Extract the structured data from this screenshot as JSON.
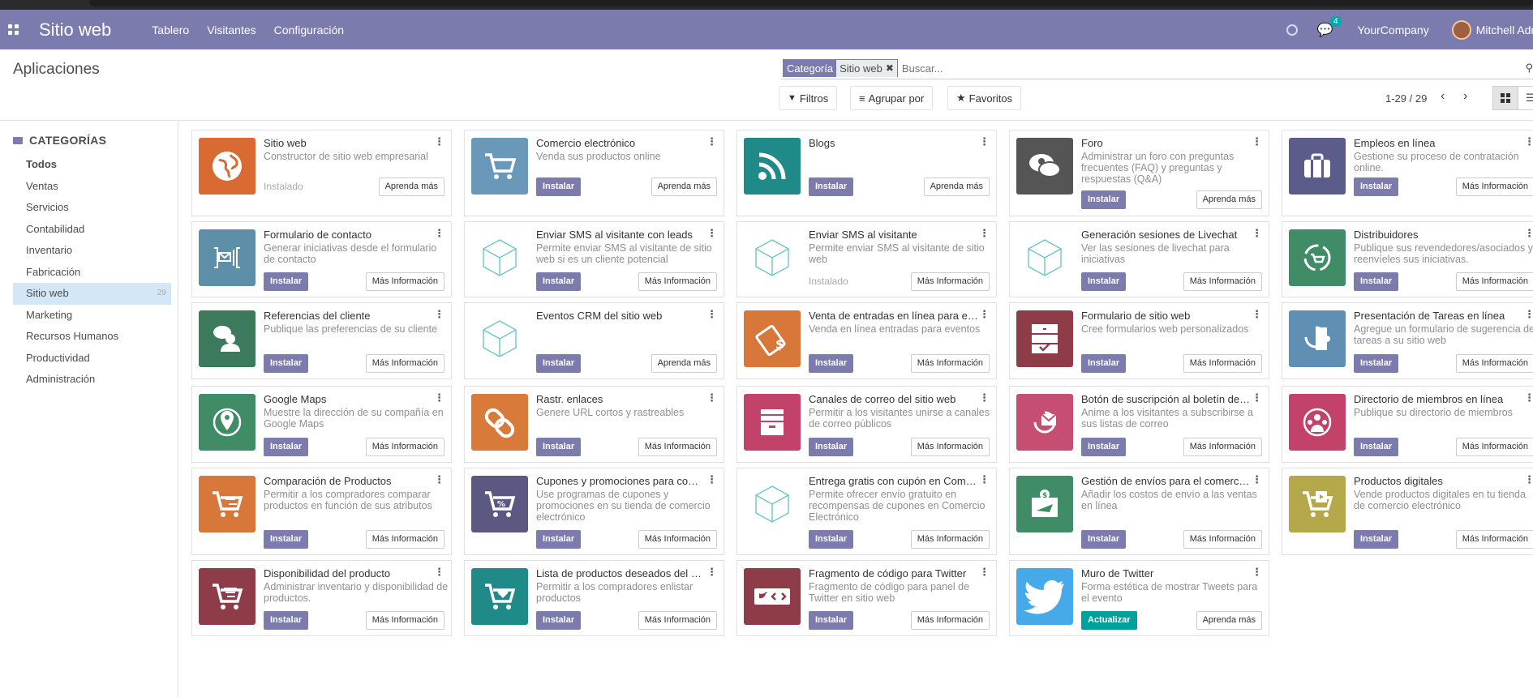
{
  "navbar": {
    "brand": "Sitio web",
    "menu": [
      "Tablero",
      "Visitantes",
      "Configuración"
    ],
    "chat_badge": "4",
    "company": "YourCompany",
    "user": "Mitchell Admin"
  },
  "control": {
    "title": "Aplicaciones",
    "facet_label": "Categoría",
    "facet_value": "Sitio web",
    "search_placeholder": "Buscar...",
    "filters": "Filtros",
    "group_by": "Agrupar por",
    "favorites": "Favoritos",
    "pager": "1-29 / 29"
  },
  "sidebar": {
    "title": "CATEGORÍAS",
    "items": [
      {
        "label": "Todos"
      },
      {
        "label": "Ventas"
      },
      {
        "label": "Servicios"
      },
      {
        "label": "Contabilidad"
      },
      {
        "label": "Inventario"
      },
      {
        "label": "Fabricación"
      },
      {
        "label": "Sitio web",
        "count": "29"
      },
      {
        "label": "Marketing"
      },
      {
        "label": "Recursos Humanos"
      },
      {
        "label": "Productividad"
      },
      {
        "label": "Administración"
      }
    ]
  },
  "apps": [
    {
      "name": "Sitio web",
      "desc": "Constructor de sitio web empresarial",
      "status": "Instalado",
      "more": "Aprenda más",
      "color": "#d86a32",
      "icon": "globe"
    },
    {
      "name": "Comercio electrónico",
      "desc": "Venda sus productos online",
      "btn": "Instalar",
      "more": "Aprenda más",
      "color": "#6a98b8",
      "icon": "cart"
    },
    {
      "name": "Blogs",
      "desc": "",
      "btn": "Instalar",
      "more": "Aprenda más",
      "color": "#1f8a87",
      "icon": "rss"
    },
    {
      "name": "Foro",
      "desc": "Administrar un foro con preguntas frecuentes (FAQ) y preguntas y respuestas (Q&A)",
      "btn": "Instalar",
      "more": "Aprenda más",
      "color": "#555555",
      "icon": "forum"
    },
    {
      "name": "Empleos en línea",
      "desc": "Gestione su proceso de contratación online.",
      "btn": "Instalar",
      "more": "Más Información",
      "color": "#5c5c8a",
      "icon": "briefcase"
    },
    {
      "name": "Formulario de contacto",
      "desc": "Generar iniciativas desde el formulario de contacto",
      "btn": "Instalar",
      "more": "Más Información",
      "color": "#5e8fa8",
      "icon": "form"
    },
    {
      "name": "Enviar SMS al visitante con leads",
      "desc": "Permite enviar SMS al visitante de sitio web si es un cliente potencial",
      "btn": "Instalar",
      "more": "Más Información",
      "color": "",
      "icon": "cube"
    },
    {
      "name": "Enviar SMS al visitante",
      "desc": "Permite enviar SMS al visitante de sitio web",
      "status": "Instalado",
      "more": "Más Información",
      "color": "",
      "icon": "cube"
    },
    {
      "name": "Generación sesiones de Livechat",
      "desc": "Ver las sesiones de livechat para iniciativas",
      "btn": "Instalar",
      "more": "Más Información",
      "color": "",
      "icon": "cube"
    },
    {
      "name": "Distribuidores",
      "desc": "Publique sus revendedores/asociados y reenvíeles sus iniciativas.",
      "btn": "Instalar",
      "more": "Más Información",
      "color": "#3f8c66",
      "icon": "cycle"
    },
    {
      "name": "Referencias del cliente",
      "desc": "Publique las preferencias de su cliente",
      "btn": "Instalar",
      "more": "Más Información",
      "color": "#3b7a5d",
      "icon": "user"
    },
    {
      "name": "Eventos CRM del sitio web",
      "desc": "",
      "btn": "Instalar",
      "more": "Aprenda más",
      "color": "",
      "icon": "cube"
    },
    {
      "name": "Venta de entradas en línea para eventos",
      "desc": "Venda en línea entradas para eventos",
      "btn": "Instalar",
      "more": "Más Información",
      "color": "#d8773a",
      "icon": "ticket"
    },
    {
      "name": "Formulario de sitio web",
      "desc": "Cree formularios web personalizados",
      "btn": "Instalar",
      "more": "Más Información",
      "color": "#8e3d48",
      "icon": "cabinet"
    },
    {
      "name": "Presentación de Tareas en línea",
      "desc": "Agregue un formulario de sugerencia de tareas a su sitio web",
      "btn": "Instalar",
      "more": "Más Información",
      "color": "#5f8fb2",
      "icon": "puzzle"
    },
    {
      "name": "Google Maps",
      "desc": "Muestre la dirección de su compañía en Google Maps",
      "btn": "Instalar",
      "more": "Más Información",
      "color": "#3f8c66",
      "icon": "pin"
    },
    {
      "name": "Rastr. enlaces",
      "desc": "Genere URL cortos y rastreables",
      "btn": "Instalar",
      "more": "Más Información",
      "color": "#d87b3a",
      "icon": "link"
    },
    {
      "name": "Canales de correo del sitio web",
      "desc": "Permitir a los visitantes unirse a canales de correo públicos",
      "btn": "Instalar",
      "more": "Más Información",
      "color": "#c2426a",
      "icon": "archive"
    },
    {
      "name": "Botón de suscripción al boletín de noticias",
      "desc": "Anime a los visitantes a subscribirse a sus listas de correo",
      "btn": "Instalar",
      "more": "Más Información",
      "color": "#c64e72",
      "icon": "mail"
    },
    {
      "name": "Directorio de miembros en línea",
      "desc": "Publique su directorio de miembros",
      "btn": "Instalar",
      "more": "Más Información",
      "color": "#c2426a",
      "icon": "group"
    },
    {
      "name": "Comparación de Productos",
      "desc": "Permitir a los compradores comparar productos en función de sus atributos",
      "btn": "Instalar",
      "more": "Más Información",
      "color": "#d8773a",
      "icon": "cart2"
    },
    {
      "name": "Cupones y promociones para comercio electrónico",
      "desc": "Use programas de cupones y promociones en su tienda de comercio electrónico",
      "btn": "Instalar",
      "more": "Más Información",
      "color": "#5b5882",
      "icon": "cartp"
    },
    {
      "name": "Entrega gratis con cupón en Comercio Electrónico",
      "desc": "Permite ofrecer envío gratuito en recompensas de cupones en Comercio Electrónico",
      "btn": "Instalar",
      "more": "Más Información",
      "color": "",
      "icon": "cube"
    },
    {
      "name": "Gestión de envíos para el comercio electrónico",
      "desc": "Añadir los costos de envío a las ventas en línea",
      "btn": "Instalar",
      "more": "Más Información",
      "color": "#3f8c66",
      "icon": "plane"
    },
    {
      "name": "Productos digitales",
      "desc": "Vende productos digitales en tu tienda de comercio electrónico",
      "btn": "Instalar",
      "more": "Más Información",
      "color": "#b5a84a",
      "icon": "cartv"
    },
    {
      "name": "Disponibilidad del producto",
      "desc": "Administrar inventario y disponibilidad de productos.",
      "btn": "Instalar",
      "more": "Más Información",
      "color": "#8e3d48",
      "icon": "cart3"
    },
    {
      "name": "Lista de productos deseados del comercio electrónico",
      "desc": "Permitir a los compradores enlistar productos",
      "btn": "Instalar",
      "more": "Más Información",
      "color": "#1f8a87",
      "icon": "cartheart"
    },
    {
      "name": "Fragmento de código para Twitter",
      "desc": "Fragmento de código para panel de Twitter en sitio web",
      "btn": "Instalar",
      "more": "Más Información",
      "color": "#8e3d48",
      "icon": "code"
    },
    {
      "name": "Muro de Twitter",
      "desc": "Forma estética de mostrar Tweets para el evento",
      "btn": "Actualizar",
      "btn_style": "upd",
      "more": "Aprenda más",
      "color": "#46a9e8",
      "icon": "twitter"
    }
  ]
}
